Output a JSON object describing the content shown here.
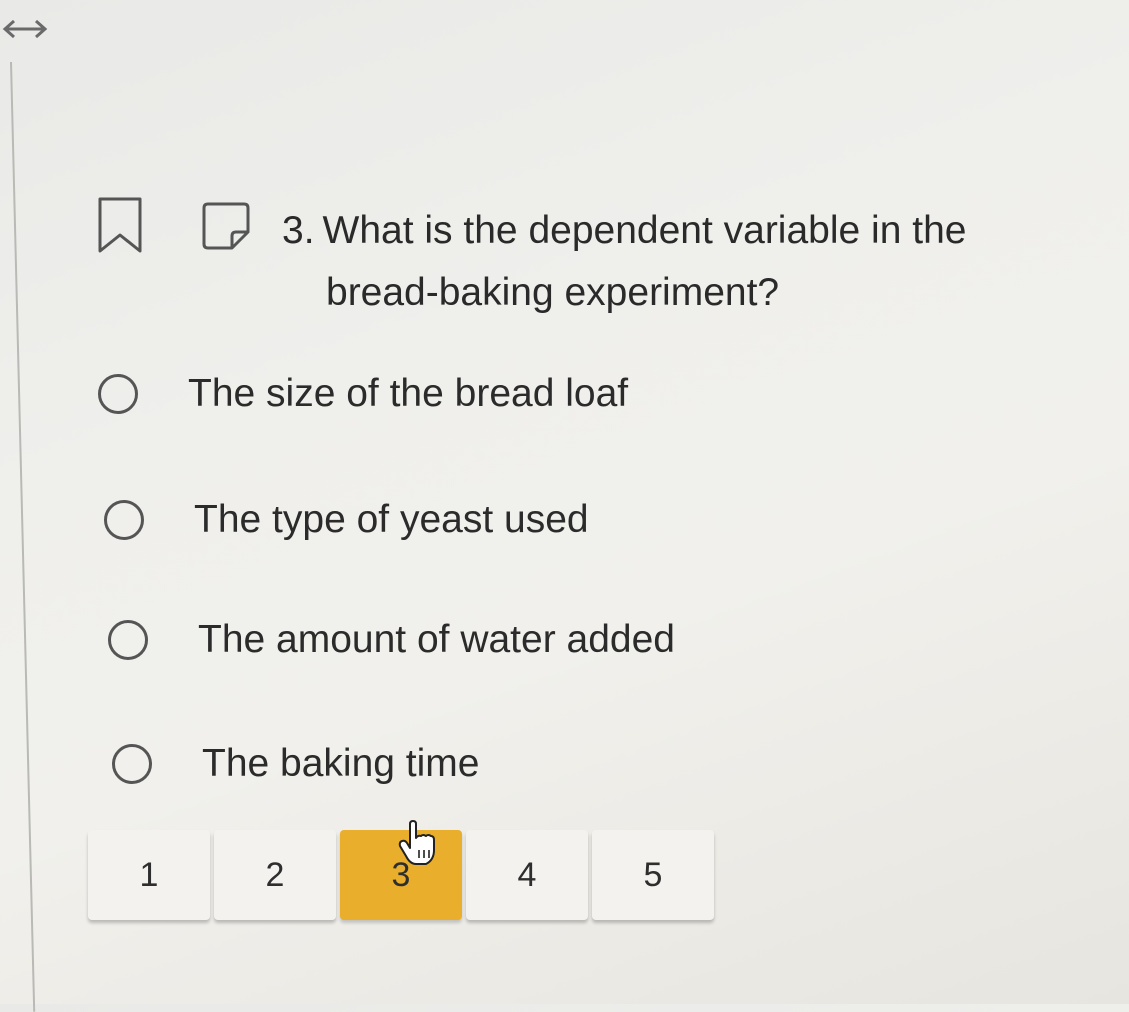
{
  "question": {
    "number": "3.",
    "text_line1": "What is the dependent variable in the",
    "text_line2": "bread-baking experiment?"
  },
  "choices": [
    {
      "label": "The size of the bread loaf"
    },
    {
      "label": "The type of yeast used"
    },
    {
      "label": "The amount of water added"
    },
    {
      "label": "The baking time"
    }
  ],
  "pagination": {
    "pages": [
      "1",
      "2",
      "3",
      "4",
      "5"
    ],
    "current": "3"
  },
  "colors": {
    "active_page": "#e9ae2b",
    "page_button": "#f3f2ef"
  },
  "icons": {
    "top_left": "resize-horizontal-icon",
    "flag": "bookmark-icon",
    "note": "note-icon",
    "pointer": "hand-pointer-icon"
  }
}
